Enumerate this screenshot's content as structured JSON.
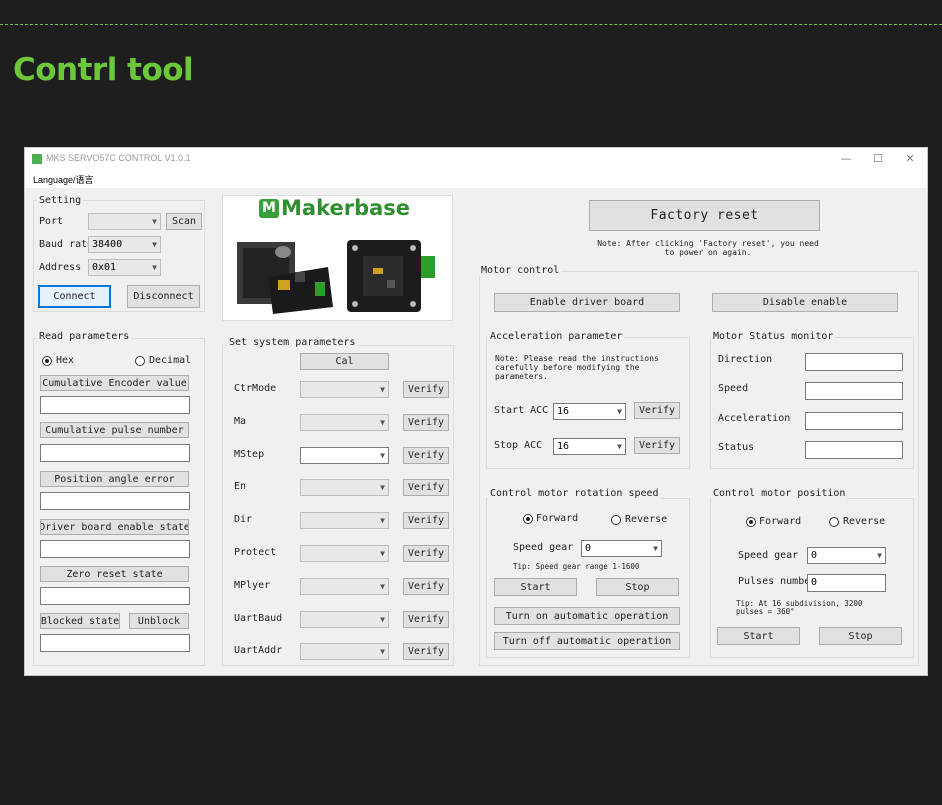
{
  "page_title": "Contrl tool",
  "window": {
    "title": "MKS SERVO57C CONTROL V1.0.1",
    "menu": "Language/语言",
    "controls": {
      "minimize": "—",
      "maximize": "☐",
      "close": "✕"
    }
  },
  "setting": {
    "title": "Setting",
    "port_label": "Port",
    "port_value": "",
    "scan": "Scan",
    "baud_label": "Baud rate",
    "baud_value": "38400",
    "address_label": "Address",
    "address_value": "0x01",
    "connect": "Connect",
    "disconnect": "Disconnect"
  },
  "logo": {
    "brand": "Makerbase",
    "mark": "M"
  },
  "read": {
    "title": "Read parameters",
    "hex": "Hex",
    "decimal": "Decimal",
    "cumulative_encoder": "Cumulative Encoder value",
    "cumulative_pulse": "Cumulative pulse number",
    "position_error": "Position angle error",
    "enable_state": "Driver board enable state",
    "zero_state": "Zero reset state",
    "blocked": "Blocked state",
    "unblock": "Unblock"
  },
  "system": {
    "title": "Set system parameters",
    "cal": "Cal",
    "verify": "Verify",
    "rows": [
      {
        "label": "CtrMode",
        "value": ""
      },
      {
        "label": "Ma",
        "value": ""
      },
      {
        "label": "MStep",
        "value": ""
      },
      {
        "label": "En",
        "value": ""
      },
      {
        "label": "Dir",
        "value": ""
      },
      {
        "label": "Protect",
        "value": ""
      },
      {
        "label": "MPlyer",
        "value": ""
      },
      {
        "label": "UartBaud",
        "value": ""
      },
      {
        "label": "UartAddr",
        "value": ""
      }
    ]
  },
  "factory": {
    "button": "Factory reset",
    "note": "Note: After clicking 'Factory reset', you need to power on again."
  },
  "motor": {
    "title": "Motor control",
    "enable": "Enable driver board",
    "disable": "Disable enable",
    "acc": {
      "title": "Acceleration parameter",
      "note": "Note: Please read the instructions carefully before modifying the parameters.",
      "start_label": "Start ACC",
      "start_value": "16",
      "stop_label": "Stop ACC",
      "stop_value": "16",
      "verify": "Verify"
    },
    "status": {
      "title": "Motor Status monitor",
      "direction": "Direction",
      "speed": "Speed",
      "acceleration": "Acceleration",
      "status": "Status"
    },
    "speed": {
      "title": "Control motor rotation speed",
      "forward": "Forward",
      "reverse": "Reverse",
      "gear_label": "Speed gear",
      "gear_value": "0",
      "tip": "Tip: Speed gear range 1-1600",
      "start": "Start",
      "stop": "Stop",
      "auto_on": "Turn on automatic operation",
      "auto_off": "Turn off automatic operation"
    },
    "position": {
      "title": "Control motor position",
      "forward": "Forward",
      "reverse": "Reverse",
      "gear_label": "Speed gear",
      "gear_value": "0",
      "pulses_label": "Pulses numbe",
      "pulses_value": "0",
      "tip": "Tip: At 16 subdivision, 3200 pulses = 360°",
      "start": "Start",
      "stop": "Stop"
    }
  }
}
